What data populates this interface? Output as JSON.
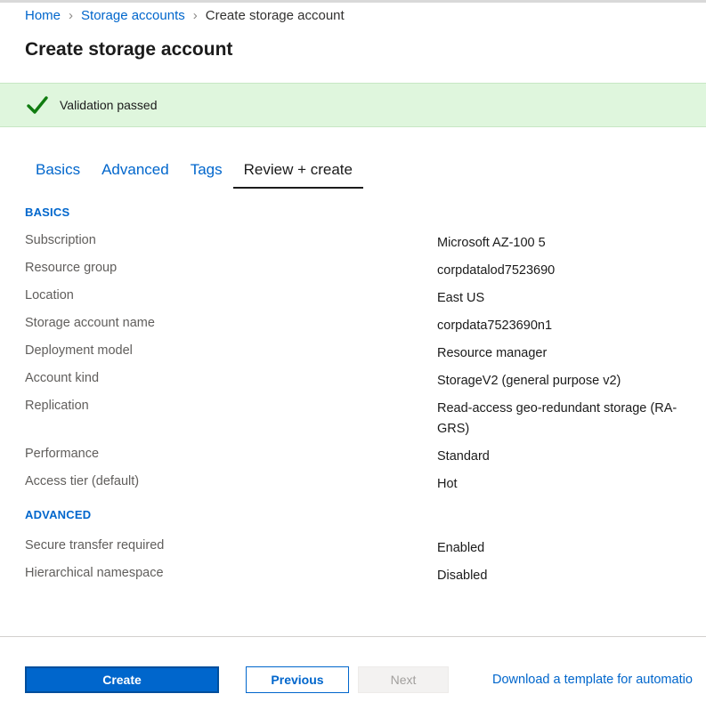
{
  "breadcrumb": {
    "items": [
      "Home",
      "Storage accounts"
    ],
    "current": "Create storage account"
  },
  "page_title": "Create storage account",
  "banner": {
    "message": "Validation passed",
    "icon": "check-icon",
    "color": "#dff6dd",
    "icon_color": "#107c10"
  },
  "tabs": [
    {
      "label": "Basics"
    },
    {
      "label": "Advanced"
    },
    {
      "label": "Tags"
    },
    {
      "label": "Review + create",
      "active": true
    }
  ],
  "sections": {
    "basics": {
      "heading": "BASICS",
      "rows": [
        {
          "label": "Subscription",
          "value": "Microsoft AZ-100 5"
        },
        {
          "label": "Resource group",
          "value": "corpdatalod7523690"
        },
        {
          "label": "Location",
          "value": "East US"
        },
        {
          "label": "Storage account name",
          "value": "corpdata7523690n1"
        },
        {
          "label": "Deployment model",
          "value": "Resource manager"
        },
        {
          "label": "Account kind",
          "value": "StorageV2 (general purpose v2)"
        },
        {
          "label": "Replication",
          "value": "Read-access geo-redundant storage (RA-GRS)"
        },
        {
          "label": "Performance",
          "value": "Standard"
        },
        {
          "label": "Access tier (default)",
          "value": "Hot"
        }
      ]
    },
    "advanced": {
      "heading": "ADVANCED",
      "rows": [
        {
          "label": "Secure transfer required",
          "value": "Enabled"
        },
        {
          "label": "Hierarchical namespace",
          "value": "Disabled"
        }
      ]
    }
  },
  "footer": {
    "create_label": "Create",
    "previous_label": "Previous",
    "next_label": "Next",
    "download_label": "Download a template for automatio"
  },
  "colors": {
    "accent": "#0066cc"
  }
}
